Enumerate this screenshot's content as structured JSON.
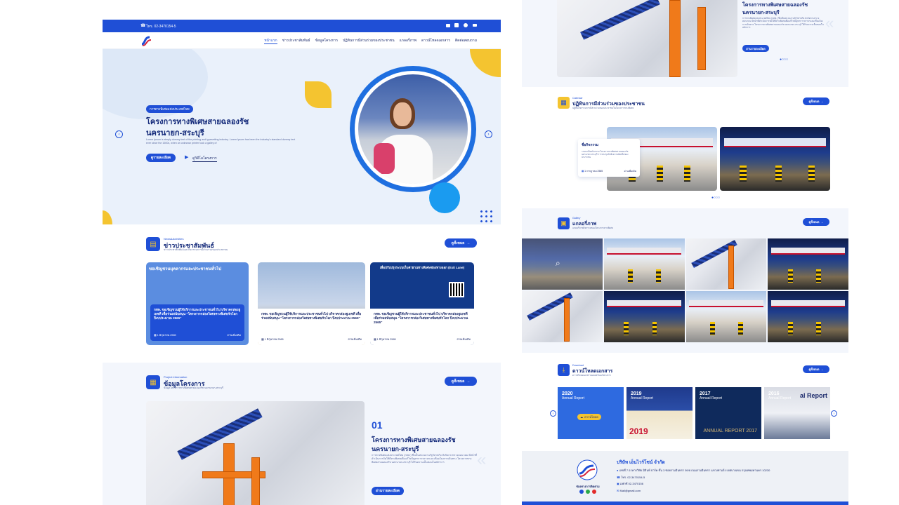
{
  "topbar": {
    "phone": "โทร. 02-3470154-5"
  },
  "nav": {
    "items": [
      "หน้าแรก",
      "ข่าวประชาสัมพันธ์",
      "ข้อมูลโครงการ",
      "ปฏิทินการมีส่วนร่วมของประชาชน",
      "แกลอรี่ภาพ",
      "ดาวน์โหลดเอกสาร",
      "ติดต่อสอบถาม"
    ]
  },
  "hero": {
    "badge": "การทางพิเศษแห่งประเทศไทย",
    "title_line1": "โครงการทางพิเศษสายฉลองรัช",
    "title_line2": "นครนายก-สระบุรี",
    "desc": "Lorem Ipsum is simply dummy text of the printing and typesetting industry. Lorem Ipsum has been the industry's standard dummy text ever since the 1500s, when an unknown printer took a galley of",
    "more_btn": "ดูรายละเอียด",
    "video_link": "ดูวิดีโอโครงการ"
  },
  "news": {
    "eyebrow": "News&Activities",
    "title": "ข่าวประชาสัมพันธ์",
    "subtitle": "ข่าวประชาสัมพันธ์และกิจกรรมการมีส่วนร่วมของประชาชน",
    "all_btn": "ดูทั้งหมด",
    "cards": [
      {
        "banner": "ขอเชิญชวนบุคลากรและประชาชนทั่วไป",
        "text": "กทพ. ขอเชิญชวนผู้ใช้บริการและประชาชนทั่วไป บริจาคกล่องยูเอชที เพื่อร่วมสนับสนุน \"โครงการกล่องวิเศษทางพิเศษรักโลก ปีงบประมาณ 2565\"",
        "date": "1 มิถุนายน 2565",
        "read": "อ่านเพิ่มเติม"
      },
      {
        "banner": "",
        "text": "กทพ. ขอเชิญชวนผู้ใช้บริการและประชาชนทั่วไป บริจาคกล่องยูเอชที เพื่อร่วมสนับสนุน \"โครงการกล่องวิเศษทางพิเศษรักโลก ปีงบประมาณ 2565\"",
        "date": "1 มิถุนายน 2565",
        "read": "อ่านเพิ่มเติม"
      },
      {
        "banner": "เพื่อปรับปรุงระบบเก็บค่าผ่านทางพิเศษช่องทางออก (Exit Lane)",
        "text": "กทพ. ขอเชิญชวนผู้ใช้บริการและประชาชนทั่วไป บริจาคกล่องยูเอชที เพื่อร่วมสนับสนุน \"โครงการกล่องวิเศษทางพิเศษรักโลก ปีงบประมาณ 2565\"",
        "date": "1 มิถุนายน 2565",
        "read": "อ่านเพิ่มเติม"
      }
    ]
  },
  "project": {
    "eyebrow": "Project information",
    "title": "ข้อมูลโครงการ",
    "subtitle": "ข้อมูลโครงการทางพิเศษสายฉลองรัช นครนายก-สระบุรี",
    "all_btn": "ดูทั้งหมด",
    "number": "01",
    "name_line1": "โครงการทางพิเศษสายฉลองรัช",
    "name_line2": "นครนายก-สระบุรี",
    "desc": "การทางพิเศษแห่งประเทศไทย (กทพ.) ซึ่งเป็นหน่วยงานรัฐวิสาหกิจ สังกัดกระทรวงคมนาคม มีหน้าที่ดำเนินการจัดให้มีทางพิเศษเพื่อแก้ไขปัญหาการจราจรและเชื่อมโยงการเดินทาง โครงการทางพิเศษสายฉลองรัช นครนายก-สระบุรี ได้รับความเห็นชอบในหลักการ",
    "more_btn": "อ่านรายละเอียด"
  },
  "calendar": {
    "eyebrow": "Calendar",
    "title": "ปฏิทินการมีส่วนร่วมของประชาชน",
    "subtitle": "ปฏิทินกิจกรรมการมีส่วนร่วมของประชาชนในโครงการทางพิเศษ",
    "all_btn": "ดูทั้งหมด",
    "event_title": "ชื่อกิจกรรม",
    "event_desc": "รายละเอียดกิจกรรม โครงการทางพิเศษสายฉลองรัช นครนายก-สระบุรี การประชุมรับฟังความคิดเห็นของประชาชน",
    "event_date": "1 กรกฎาคม 2565",
    "event_read": "อ่านเพิ่มเติม"
  },
  "gallery": {
    "eyebrow": "Gallery",
    "title": "แกลอรี่ภาพ",
    "subtitle": "แกลอรี่ภาพกิจกรรมของโครงการทางพิเศษ",
    "all_btn": "ดูทั้งหมด"
  },
  "download": {
    "eyebrow": "Download",
    "title": "ดาวน์โหลดเอกสาร",
    "subtitle": "ดาวน์โหลดเอกสารเผยแพร่ของโครงการ",
    "all_btn": "ดูทั้งหมด",
    "reports": [
      {
        "year": "2020",
        "label": "Annual Report",
        "btn": "ดาวน์โหลด",
        "big": ""
      },
      {
        "year": "2019",
        "label": "Annual Report",
        "btn": "",
        "big": "2019"
      },
      {
        "year": "2017",
        "label": "Annual Report",
        "btn": "",
        "big": "ANNUAL REPORT 2017"
      },
      {
        "year": "2016",
        "label": "Annual Report",
        "btn": "",
        "big": "al Report"
      }
    ]
  },
  "footer": {
    "company": "บริษัท เอ็นไวร์โซน์ จำกัด",
    "logo_caption": "ช่องทางการติดตาม",
    "address": "เลขที่ 7 อาคารวิทัย มิลินท์ ปาร์ค ชั้น 3 ซอยรามอินทรา 59/8 ถนนรามอินทรา แขวงท่าแร้ง เขตบางเขน กรุงเทพมหานคร 10230",
    "tel": "โทร. 02-3470154-5",
    "fax": "แฟกซ์ 02-3470156",
    "mail": "Mail@gmail.com"
  },
  "colors": {
    "primary": "#1f4fd6",
    "accent": "#f4c430",
    "bg_light": "#f3f6fc"
  }
}
